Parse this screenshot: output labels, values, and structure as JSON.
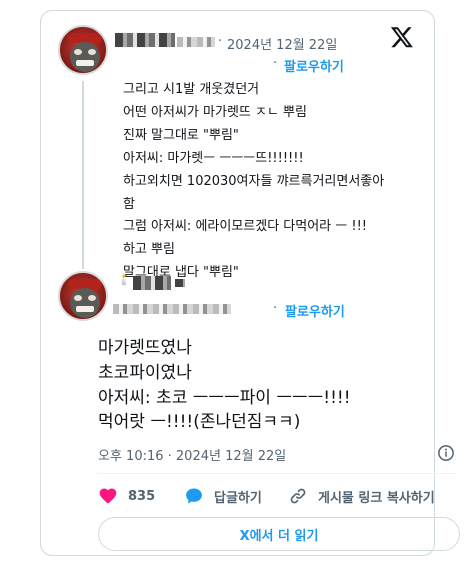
{
  "first_post": {
    "date": "2024년 12월 22일",
    "follow_label": "팔로우하기",
    "lines": [
      "그리고 시1발 개웃겼던거",
      "어떤 아저씨가 마가렛뜨 ㅈㄴ 뿌림",
      "진짜 말그대로 \"뿌림\"",
      "아저씨: 마가렛ㅡ ㅡㅡㅡ뜨!!!!!!!",
      "하고외치면 102030여자들 꺄르륵거리면서좋아",
      "함",
      "그럼 아저씨: 에라이모르겠다 다먹어라 ㅡ !!!",
      "하고 뿌림",
      "말그대로 냅다 \"뿌림\""
    ]
  },
  "second_post": {
    "follow_label": "팔로우하기",
    "candle": "🕯️",
    "lines": [
      "마가렛뜨였나",
      "초코파이였나",
      "아저씨: 초코 ㅡㅡㅡ파이 ㅡㅡㅡ!!!!",
      "먹어랏 ㅡ!!!!(존나던짐ㅋㅋ)"
    ],
    "timestamp": "오후 10:16 · 2024년 12월 22일"
  },
  "actions": {
    "like_count": "835",
    "reply_label": "답글하기",
    "copy_link_label": "게시물 링크 복사하기"
  },
  "read_more_label": "X에서 더 읽기",
  "colors": {
    "accent": "#1d9bf0",
    "like": "#f91880",
    "text": "#0f1419",
    "muted": "#536471"
  }
}
